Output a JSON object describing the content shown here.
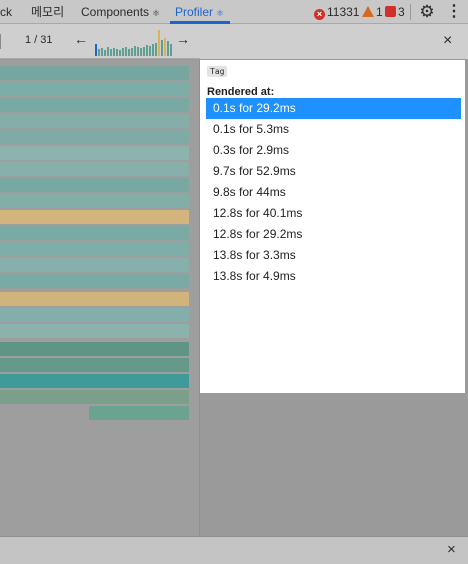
{
  "tabs": [
    {
      "label": "ck"
    },
    {
      "label": "메모리"
    },
    {
      "label": "Components"
    },
    {
      "label": "Profiler"
    }
  ],
  "tab_icon_glyph": "⚛",
  "status": {
    "errors": "11331",
    "warnings": "1",
    "issues": "3"
  },
  "toolbar": {
    "commit_counter": "1 / 31",
    "prev_glyph": "←",
    "next_glyph": "→"
  },
  "commit_chart_colors": {
    "selected": "#1a66c9",
    "normal": "#5f9e92",
    "hot": "#d9b35c"
  },
  "sidebar": {
    "tag": "Tag",
    "rendered_at_label": "Rendered at:",
    "close_glyph": "×",
    "renders": [
      {
        "label": "0.1s for 29.2ms",
        "selected": true
      },
      {
        "label": "0.1s for 5.3ms",
        "selected": false
      },
      {
        "label": "0.3s for 2.9ms",
        "selected": false
      },
      {
        "label": "9.7s for 52.9ms",
        "selected": false
      },
      {
        "label": "9.8s for 44ms",
        "selected": false
      },
      {
        "label": "12.8s for 40.1ms",
        "selected": false
      },
      {
        "label": "12.8s for 29.2ms",
        "selected": false
      },
      {
        "label": "13.8s for 3.3ms",
        "selected": false
      },
      {
        "label": "13.8s for 4.9ms",
        "selected": false
      }
    ]
  },
  "drawer": {
    "close_glyph": "×"
  },
  "icons": {
    "settings": "gear-icon",
    "more": "kebab-menu-icon",
    "error": "error-icon",
    "warning": "warning-icon",
    "issue": "issue-icon"
  }
}
